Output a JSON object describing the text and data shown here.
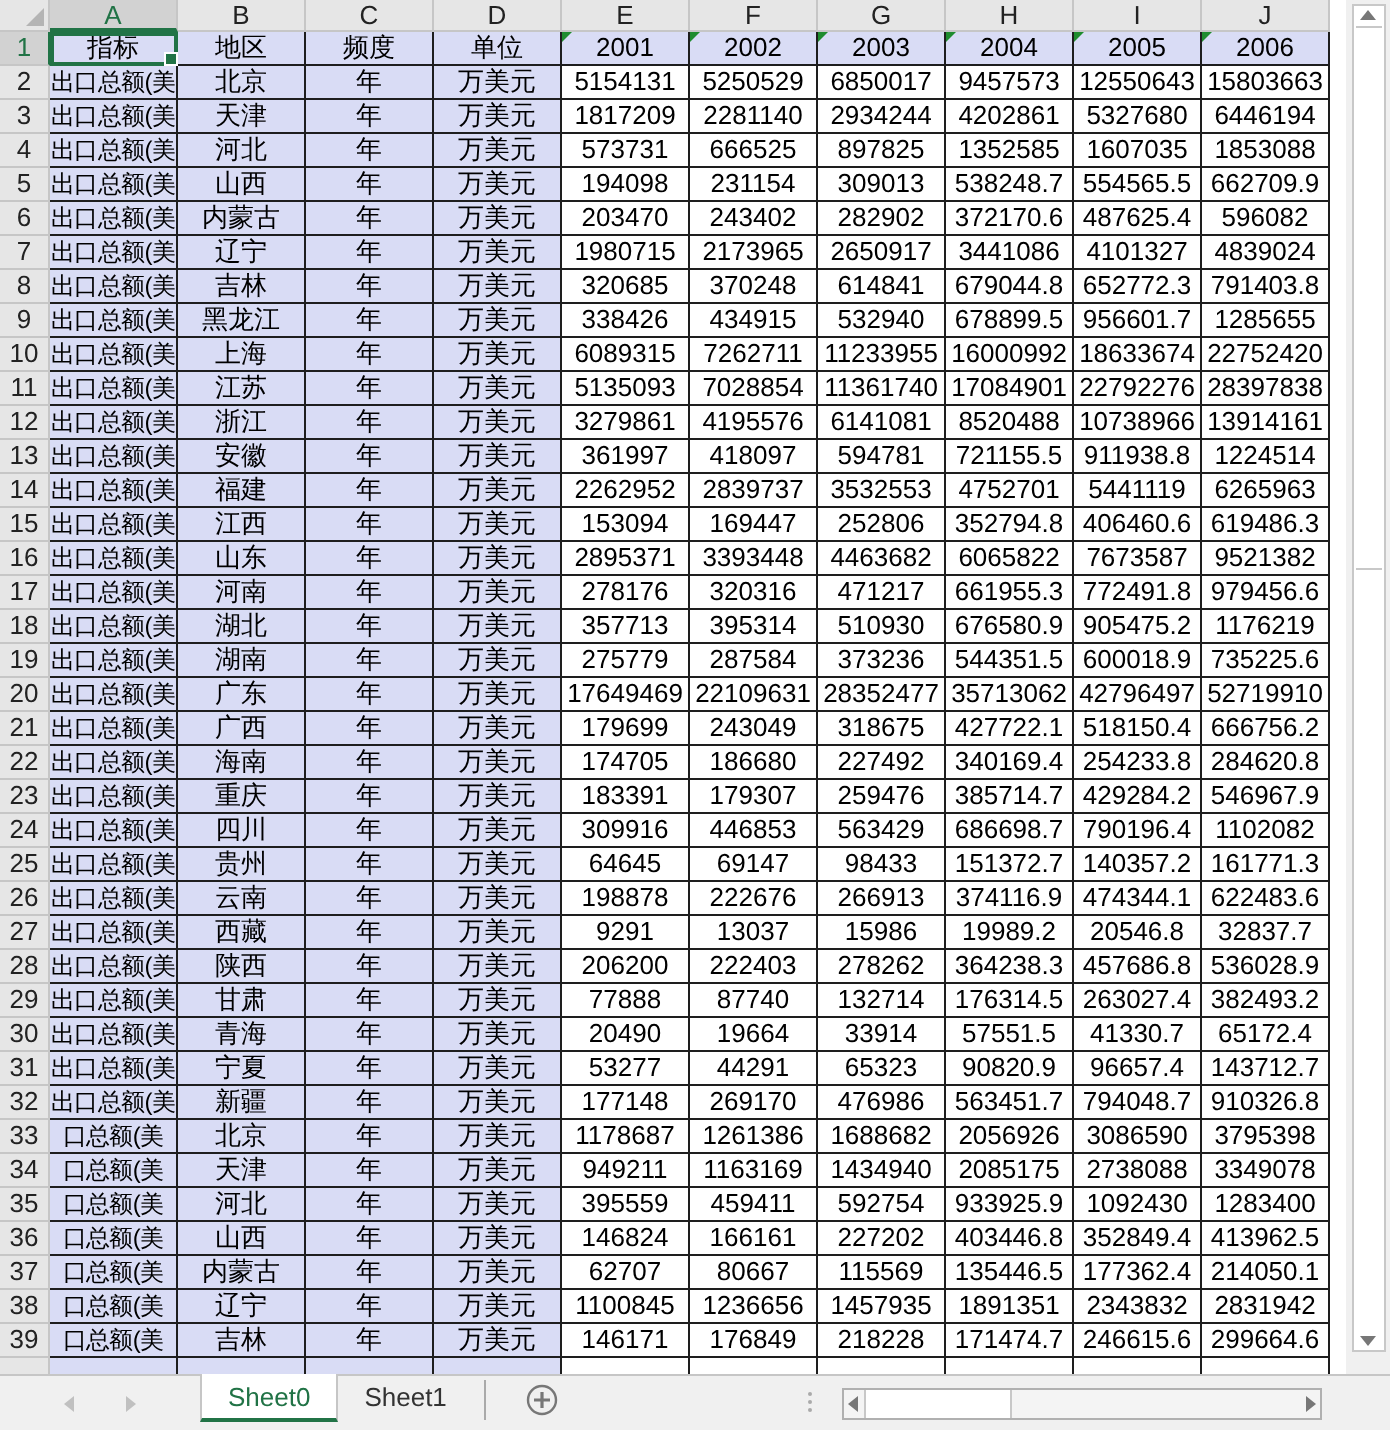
{
  "columns": [
    {
      "letter": "A",
      "selected": true
    },
    {
      "letter": "B",
      "selected": false
    },
    {
      "letter": "C",
      "selected": false
    },
    {
      "letter": "D",
      "selected": false
    },
    {
      "letter": "E",
      "selected": false
    },
    {
      "letter": "F",
      "selected": false
    },
    {
      "letter": "G",
      "selected": false
    },
    {
      "letter": "H",
      "selected": false
    },
    {
      "letter": "I",
      "selected": false
    },
    {
      "letter": "J",
      "selected": false
    }
  ],
  "header_row": {
    "number": "1",
    "selected": true,
    "cells": [
      {
        "text": "指标",
        "flag": false
      },
      {
        "text": "地区",
        "flag": false
      },
      {
        "text": "频度",
        "flag": false
      },
      {
        "text": "单位",
        "flag": false
      },
      {
        "text": "2001",
        "flag": true
      },
      {
        "text": "2002",
        "flag": true
      },
      {
        "text": "2003",
        "flag": true
      },
      {
        "text": "2004",
        "flag": true
      },
      {
        "text": "2005",
        "flag": true
      },
      {
        "text": "2006",
        "flag": true
      }
    ]
  },
  "rows": [
    {
      "number": "2",
      "cells": [
        "出口总额(美",
        "北京",
        "年",
        "万美元",
        "5154131",
        "5250529",
        "6850017",
        "9457573",
        "12550643",
        "15803663"
      ]
    },
    {
      "number": "3",
      "cells": [
        "出口总额(美",
        "天津",
        "年",
        "万美元",
        "1817209",
        "2281140",
        "2934244",
        "4202861",
        "5327680",
        "6446194"
      ]
    },
    {
      "number": "4",
      "cells": [
        "出口总额(美",
        "河北",
        "年",
        "万美元",
        "573731",
        "666525",
        "897825",
        "1352585",
        "1607035",
        "1853088"
      ]
    },
    {
      "number": "5",
      "cells": [
        "出口总额(美",
        "山西",
        "年",
        "万美元",
        "194098",
        "231154",
        "309013",
        "538248.7",
        "554565.5",
        "662709.9"
      ]
    },
    {
      "number": "6",
      "cells": [
        "出口总额(美",
        "内蒙古",
        "年",
        "万美元",
        "203470",
        "243402",
        "282902",
        "372170.6",
        "487625.4",
        "596082"
      ]
    },
    {
      "number": "7",
      "cells": [
        "出口总额(美",
        "辽宁",
        "年",
        "万美元",
        "1980715",
        "2173965",
        "2650917",
        "3441086",
        "4101327",
        "4839024"
      ]
    },
    {
      "number": "8",
      "cells": [
        "出口总额(美",
        "吉林",
        "年",
        "万美元",
        "320685",
        "370248",
        "614841",
        "679044.8",
        "652772.3",
        "791403.8"
      ]
    },
    {
      "number": "9",
      "cells": [
        "出口总额(美",
        "黑龙江",
        "年",
        "万美元",
        "338426",
        "434915",
        "532940",
        "678899.5",
        "956601.7",
        "1285655"
      ]
    },
    {
      "number": "10",
      "cells": [
        "出口总额(美",
        "上海",
        "年",
        "万美元",
        "6089315",
        "7262711",
        "11233955",
        "16000992",
        "18633674",
        "22752420"
      ]
    },
    {
      "number": "11",
      "cells": [
        "出口总额(美",
        "江苏",
        "年",
        "万美元",
        "5135093",
        "7028854",
        "11361740",
        "17084901",
        "22792276",
        "28397838"
      ]
    },
    {
      "number": "12",
      "cells": [
        "出口总额(美",
        "浙江",
        "年",
        "万美元",
        "3279861",
        "4195576",
        "6141081",
        "8520488",
        "10738966",
        "13914161"
      ]
    },
    {
      "number": "13",
      "cells": [
        "出口总额(美",
        "安徽",
        "年",
        "万美元",
        "361997",
        "418097",
        "594781",
        "721155.5",
        "911938.8",
        "1224514"
      ]
    },
    {
      "number": "14",
      "cells": [
        "出口总额(美",
        "福建",
        "年",
        "万美元",
        "2262952",
        "2839737",
        "3532553",
        "4752701",
        "5441119",
        "6265963"
      ]
    },
    {
      "number": "15",
      "cells": [
        "出口总额(美",
        "江西",
        "年",
        "万美元",
        "153094",
        "169447",
        "252806",
        "352794.8",
        "406460.6",
        "619486.3"
      ]
    },
    {
      "number": "16",
      "cells": [
        "出口总额(美",
        "山东",
        "年",
        "万美元",
        "2895371",
        "3393448",
        "4463682",
        "6065822",
        "7673587",
        "9521382"
      ]
    },
    {
      "number": "17",
      "cells": [
        "出口总额(美",
        "河南",
        "年",
        "万美元",
        "278176",
        "320316",
        "471217",
        "661955.3",
        "772491.8",
        "979456.6"
      ]
    },
    {
      "number": "18",
      "cells": [
        "出口总额(美",
        "湖北",
        "年",
        "万美元",
        "357713",
        "395314",
        "510930",
        "676580.9",
        "905475.2",
        "1176219"
      ]
    },
    {
      "number": "19",
      "cells": [
        "出口总额(美",
        "湖南",
        "年",
        "万美元",
        "275779",
        "287584",
        "373236",
        "544351.5",
        "600018.9",
        "735225.6"
      ]
    },
    {
      "number": "20",
      "cells": [
        "出口总额(美",
        "广东",
        "年",
        "万美元",
        "17649469",
        "22109631",
        "28352477",
        "35713062",
        "42796497",
        "52719910"
      ]
    },
    {
      "number": "21",
      "cells": [
        "出口总额(美",
        "广西",
        "年",
        "万美元",
        "179699",
        "243049",
        "318675",
        "427722.1",
        "518150.4",
        "666756.2"
      ]
    },
    {
      "number": "22",
      "cells": [
        "出口总额(美",
        "海南",
        "年",
        "万美元",
        "174705",
        "186680",
        "227492",
        "340169.4",
        "254233.8",
        "284620.8"
      ]
    },
    {
      "number": "23",
      "cells": [
        "出口总额(美",
        "重庆",
        "年",
        "万美元",
        "183391",
        "179307",
        "259476",
        "385714.7",
        "429284.2",
        "546967.9"
      ]
    },
    {
      "number": "24",
      "cells": [
        "出口总额(美",
        "四川",
        "年",
        "万美元",
        "309916",
        "446853",
        "563429",
        "686698.7",
        "790196.4",
        "1102082"
      ]
    },
    {
      "number": "25",
      "cells": [
        "出口总额(美",
        "贵州",
        "年",
        "万美元",
        "64645",
        "69147",
        "98433",
        "151372.7",
        "140357.2",
        "161771.3"
      ]
    },
    {
      "number": "26",
      "cells": [
        "出口总额(美",
        "云南",
        "年",
        "万美元",
        "198878",
        "222676",
        "266913",
        "374116.9",
        "474344.1",
        "622483.6"
      ]
    },
    {
      "number": "27",
      "cells": [
        "出口总额(美",
        "西藏",
        "年",
        "万美元",
        "9291",
        "13037",
        "15986",
        "19989.2",
        "20546.8",
        "32837.7"
      ]
    },
    {
      "number": "28",
      "cells": [
        "出口总额(美",
        "陕西",
        "年",
        "万美元",
        "206200",
        "222403",
        "278262",
        "364238.3",
        "457686.8",
        "536028.9"
      ]
    },
    {
      "number": "29",
      "cells": [
        "出口总额(美",
        "甘肃",
        "年",
        "万美元",
        "77888",
        "87740",
        "132714",
        "176314.5",
        "263027.4",
        "382493.2"
      ]
    },
    {
      "number": "30",
      "cells": [
        "出口总额(美",
        "青海",
        "年",
        "万美元",
        "20490",
        "19664",
        "33914",
        "57551.5",
        "41330.7",
        "65172.4"
      ]
    },
    {
      "number": "31",
      "cells": [
        "出口总额(美",
        "宁夏",
        "年",
        "万美元",
        "53277",
        "44291",
        "65323",
        "90820.9",
        "96657.4",
        "143712.7"
      ]
    },
    {
      "number": "32",
      "cells": [
        "出口总额(美",
        "新疆",
        "年",
        "万美元",
        "177148",
        "269170",
        "476986",
        "563451.7",
        "794048.7",
        "910326.8"
      ]
    },
    {
      "number": "33",
      "cells": [
        "口总额(美",
        "北京",
        "年",
        "万美元",
        "1178687",
        "1261386",
        "1688682",
        "2056926",
        "3086590",
        "3795398"
      ]
    },
    {
      "number": "34",
      "cells": [
        "口总额(美",
        "天津",
        "年",
        "万美元",
        "949211",
        "1163169",
        "1434940",
        "2085175",
        "2738088",
        "3349078"
      ]
    },
    {
      "number": "35",
      "cells": [
        "口总额(美",
        "河北",
        "年",
        "万美元",
        "395559",
        "459411",
        "592754",
        "933925.9",
        "1092430",
        "1283400"
      ]
    },
    {
      "number": "36",
      "cells": [
        "口总额(美",
        "山西",
        "年",
        "万美元",
        "146824",
        "166161",
        "227202",
        "403446.8",
        "352849.4",
        "413962.5"
      ]
    },
    {
      "number": "37",
      "cells": [
        "口总额(美",
        "内蒙古",
        "年",
        "万美元",
        "62707",
        "80667",
        "115569",
        "135446.5",
        "177362.4",
        "214050.1"
      ]
    },
    {
      "number": "38",
      "cells": [
        "口总额(美",
        "辽宁",
        "年",
        "万美元",
        "1100845",
        "1236656",
        "1457935",
        "1891351",
        "2343832",
        "2831942"
      ]
    },
    {
      "number": "39",
      "cells": [
        "口总额(美",
        "吉林",
        "年",
        "万美元",
        "146171",
        "176849",
        "218228",
        "171474.7",
        "246615.6",
        "299664.6"
      ]
    }
  ],
  "sheet_tabs": [
    {
      "label": "Sheet0",
      "selected": true
    },
    {
      "label": "Sheet1",
      "selected": false
    }
  ]
}
